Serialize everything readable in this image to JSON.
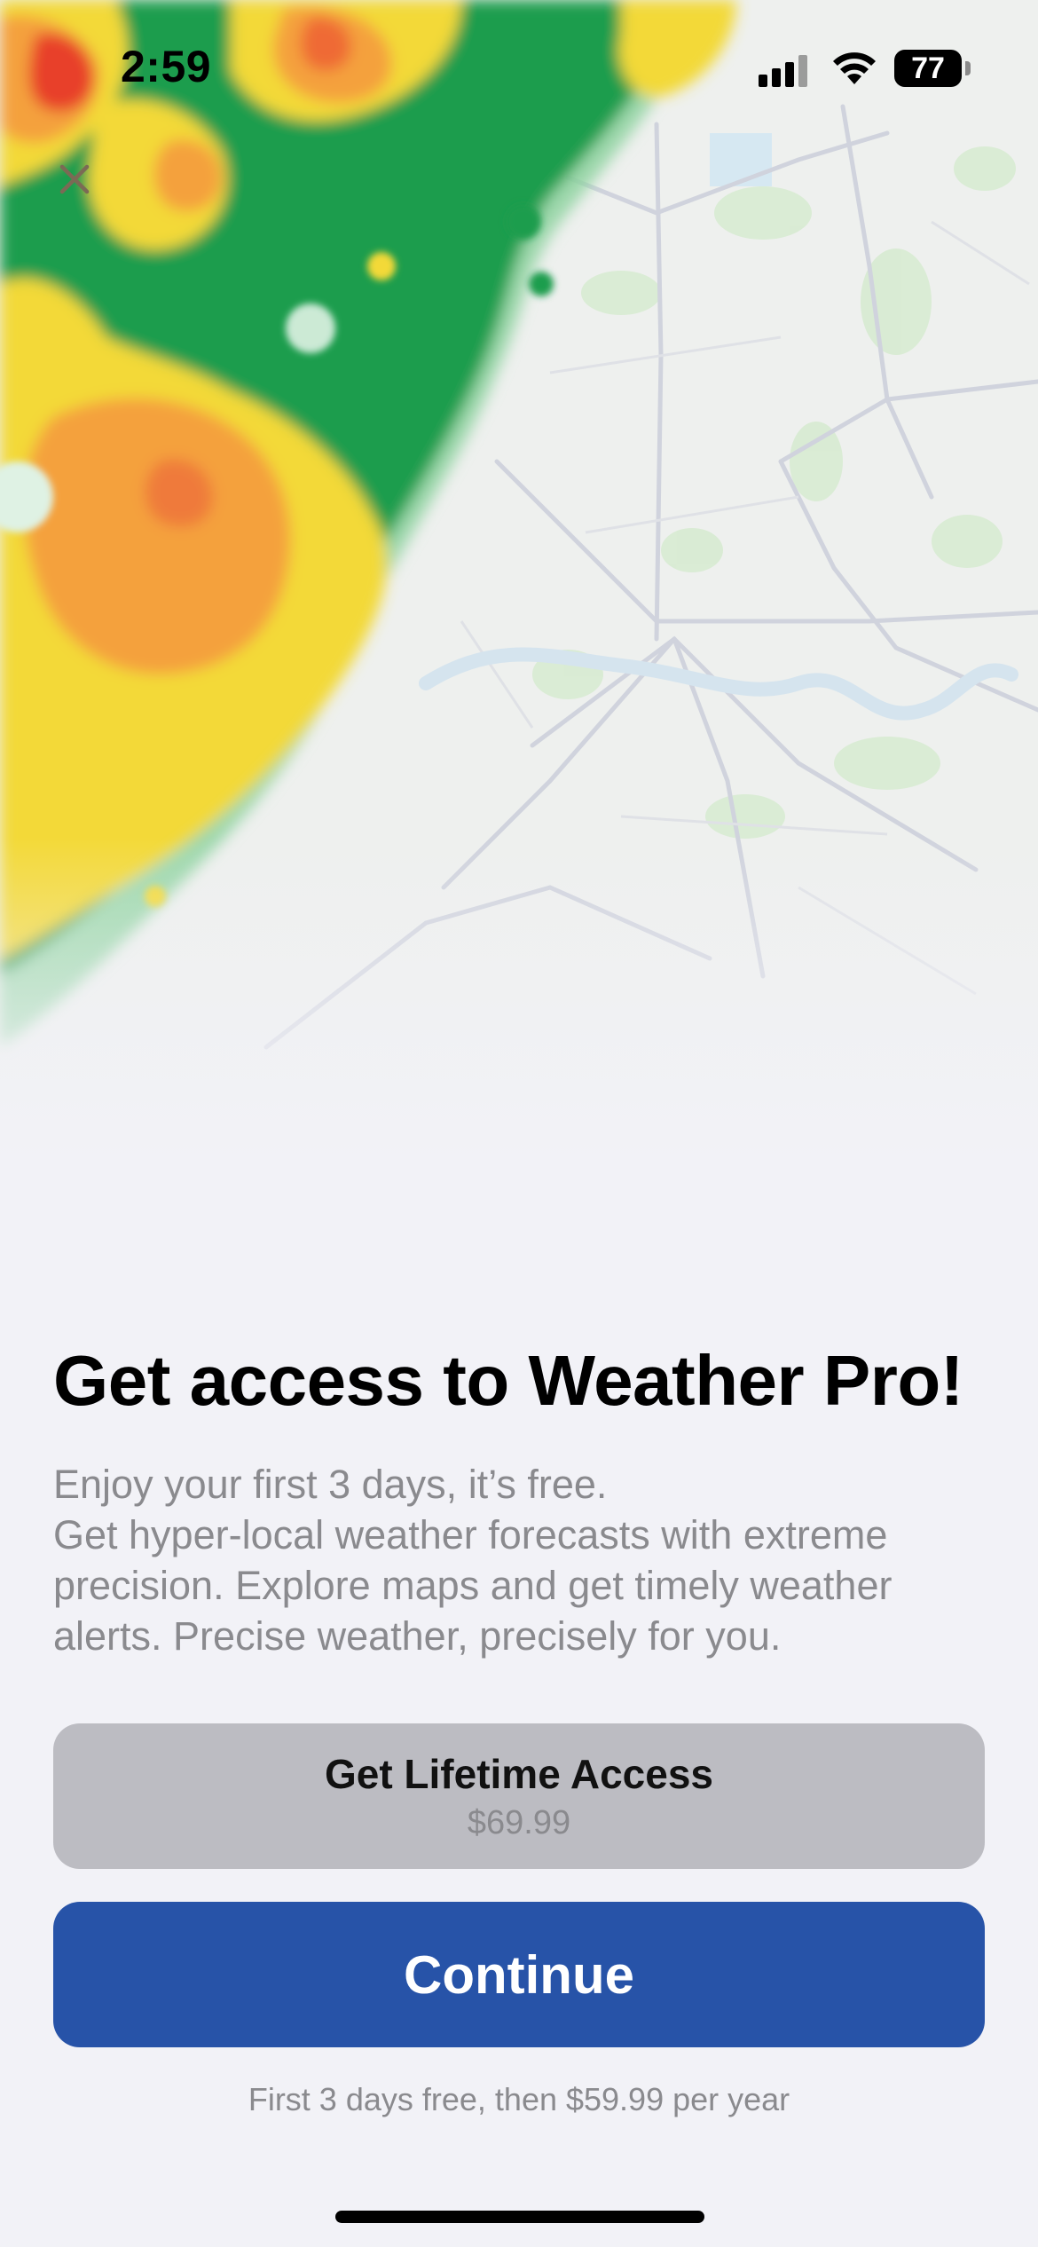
{
  "status_bar": {
    "time": "2:59",
    "battery": "77"
  },
  "icons": {
    "close": "close-icon",
    "signal": "cellular-signal-icon",
    "wifi": "wifi-icon",
    "battery": "battery-icon"
  },
  "paywall": {
    "title": "Get access to Weather Pro!",
    "description_lines": [
      "Enjoy your first 3 days, it’s free.",
      "Get hyper-local weather forecasts with extreme",
      "precision. Explore maps and get timely weather",
      "alerts. Precise weather, precisely for you."
    ],
    "lifetime_button": {
      "label": "Get Lifetime Access",
      "price": "$69.99"
    },
    "continue_button": {
      "label": "Continue"
    },
    "terms": "First 3 days free, then $59.99 per year"
  },
  "colors": {
    "background": "#f2f2f7",
    "primary_button": "#2753a8",
    "secondary_button": "#bcbcc2",
    "secondary_text": "#8a8a8e",
    "radar_green": "#1f9d4d",
    "radar_yellow": "#f3d939",
    "radar_orange": "#f4a13c",
    "radar_red": "#e8402a"
  }
}
